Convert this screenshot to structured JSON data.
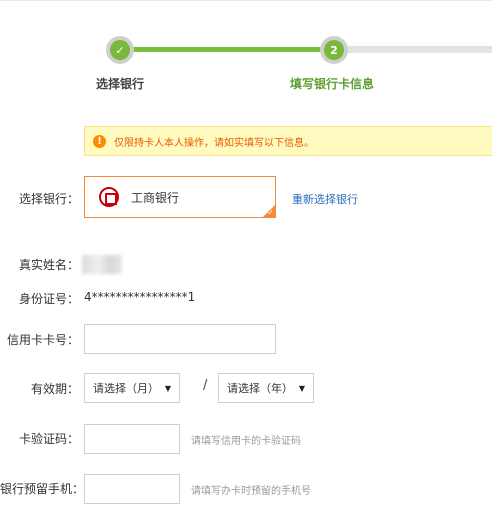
{
  "stepper": {
    "steps": [
      {
        "mark": "✓",
        "label": "选择银行",
        "state": "done"
      },
      {
        "mark": "2",
        "label": "填写银行卡信息",
        "state": "current"
      }
    ]
  },
  "notice": {
    "icon": "alert-icon",
    "text": "仅限持卡人本人操作，请如实填写以下信息。"
  },
  "form": {
    "bank": {
      "label": "选择银行：",
      "bank_name": "工商银行",
      "reselect_link": "重新选择银行"
    },
    "real_name": {
      "label": "真实姓名："
    },
    "id_number": {
      "label": "身份证号：",
      "value": "4****************1"
    },
    "card_number": {
      "label": "信用卡卡号：",
      "value": ""
    },
    "expiry": {
      "label": "有效期：",
      "month_selected": "请选择（月）",
      "separator": "/",
      "year_selected": "请选择（年）"
    },
    "cvv": {
      "label": "卡验证码：",
      "value": "",
      "hint": "请填写信用卡的卡验证码"
    },
    "phone": {
      "label": "银行预留手机：",
      "value": "",
      "hint": "请填写办卡时预留的手机号"
    }
  },
  "colors": {
    "accent_green": "#7cbf3f",
    "step_done": "#79b83a",
    "bank_border": "#f08a3c",
    "link_blue": "#2a6cc0",
    "notice_bg": "#fffabf",
    "notice_text": "#e65c00",
    "icbc_red": "#c7000b"
  }
}
